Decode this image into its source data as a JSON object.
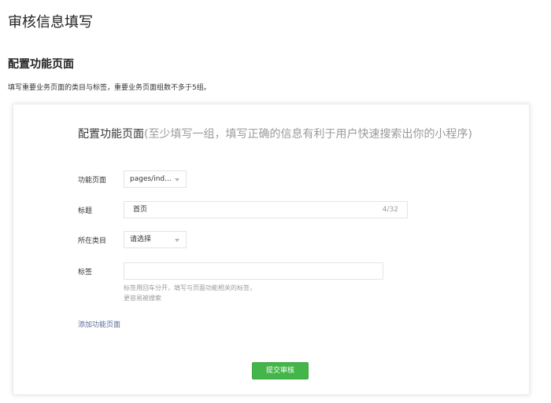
{
  "page": {
    "title": "审核信息填写"
  },
  "section": {
    "title": "配置功能页面",
    "description": "填写重要业务页面的类目与标签，重要业务页面组数不多于5组。"
  },
  "form": {
    "heading_main": "配置功能页面",
    "heading_hint": "(至少填写一组，填写正确的信息有利于用户快速搜索出你的小程序)",
    "function_page": {
      "label": "功能页面",
      "value": "pages/ind..."
    },
    "title_field": {
      "label": "标题",
      "value": "首页",
      "counter": "4/32"
    },
    "category": {
      "label": "所在类目",
      "value": "请选择"
    },
    "tags": {
      "label": "标签",
      "value": "",
      "help_line1": "标签用回车分开，填写与页面功能相关的标签，",
      "help_line2": "更容易被搜索"
    },
    "add_link": "添加功能页面",
    "submit_label": "提交审核"
  },
  "colors": {
    "primary": "#44b549",
    "link": "#576b95",
    "hint": "#9a9a9a"
  }
}
